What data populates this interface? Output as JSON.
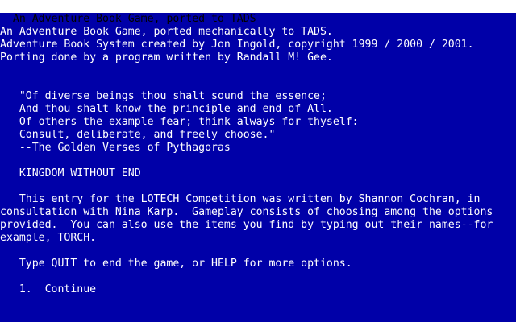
{
  "status_bar": {
    "title": "An Adventure Book Game, ported to TADS"
  },
  "transcript": {
    "lines": [
      "An Adventure Book Game, ported mechanically to TADS.",
      "Adventure Book System created by Jon Ingold, copyright 1999 / 2000 / 2001.",
      "Porting done by a program written by Randall M! Gee.",
      "",
      "",
      "   \"Of diverse beings thou shalt sound the essence;",
      "   And thou shalt know the principle and end of All.",
      "   Of others the example fear; think always for thyself:",
      "   Consult, deliberate, and freely choose.\"",
      "   --The Golden Verses of Pythagoras",
      "",
      "   KINGDOM WITHOUT END",
      "",
      "   This entry for the LOTECH Competition was written by Shannon Cochran, in",
      "consultation with Nina Karp.  Gameplay consists of choosing among the options",
      "provided.  You can also use the items you find by typing out their names--for",
      "example, TORCH.",
      "",
      "   Type QUIT to end the game, or HELP for more options.",
      "",
      "   1.  Continue"
    ]
  },
  "prompt": {
    "symbol": ">"
  }
}
